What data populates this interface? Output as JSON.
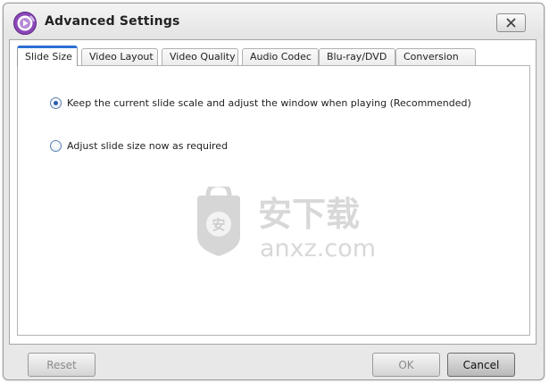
{
  "window": {
    "title": "Advanced Settings",
    "close_label": "X"
  },
  "tabs": [
    {
      "label": "Slide Size",
      "active": true
    },
    {
      "label": "Video Layout",
      "active": false
    },
    {
      "label": "Video Quality",
      "active": false
    },
    {
      "label": "Audio Codec",
      "active": false
    },
    {
      "label": "Blu-ray/DVD",
      "active": false
    },
    {
      "label": "Conversion",
      "active": false
    }
  ],
  "slide_size": {
    "options": [
      {
        "label": "Keep the current slide scale and adjust the window when playing (Recommended)",
        "selected": true
      },
      {
        "label": "Adjust slide size now as required",
        "selected": false
      }
    ]
  },
  "watermark": {
    "text_cn": "安下载",
    "text_en": "anxz.com",
    "badge_char": "安"
  },
  "buttons": {
    "reset": "Reset",
    "ok": "OK",
    "cancel": "Cancel"
  },
  "colors": {
    "tab_accent": "#2b6ed3",
    "logo_purple": "#7b3fa8",
    "radio_dot": "#2a5db0"
  }
}
